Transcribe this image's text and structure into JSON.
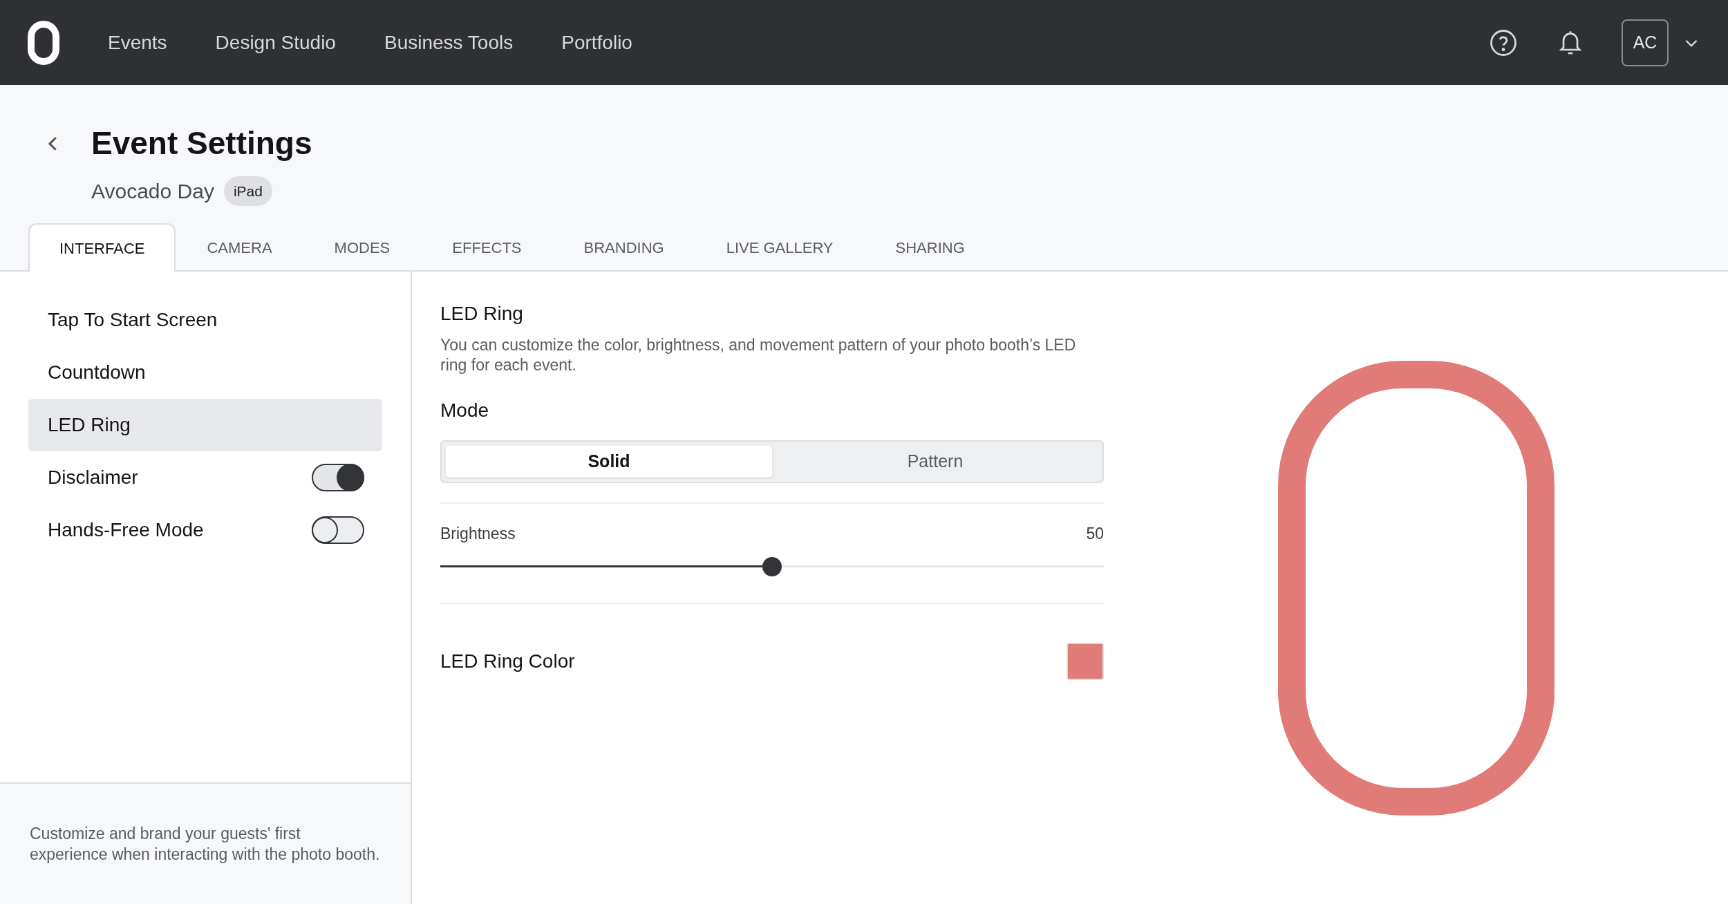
{
  "nav": {
    "links": [
      "Events",
      "Design Studio",
      "Business Tools",
      "Portfolio"
    ],
    "avatar": "AC"
  },
  "page": {
    "title": "Event Settings",
    "event_name": "Avocado Day",
    "device_badge": "iPad"
  },
  "tabs": [
    {
      "label": "INTERFACE",
      "selected": true
    },
    {
      "label": "CAMERA",
      "selected": false
    },
    {
      "label": "MODES",
      "selected": false
    },
    {
      "label": "EFFECTS",
      "selected": false
    },
    {
      "label": "BRANDING",
      "selected": false
    },
    {
      "label": "LIVE GALLERY",
      "selected": false
    },
    {
      "label": "SHARING",
      "selected": false
    }
  ],
  "sidebar": {
    "items": [
      {
        "label": "Tap To Start Screen",
        "kind": "link",
        "selected": false
      },
      {
        "label": "Countdown",
        "kind": "link",
        "selected": false
      },
      {
        "label": "LED Ring",
        "kind": "link",
        "selected": true
      },
      {
        "label": "Disclaimer",
        "kind": "toggle",
        "selected": false,
        "on": true
      },
      {
        "label": "Hands-Free Mode",
        "kind": "toggle",
        "selected": false,
        "on": false
      }
    ],
    "footer": "Customize and brand your guests' first experience when interacting with the photo booth."
  },
  "panel": {
    "title": "LED Ring",
    "description": "You can customize the color, brightness, and movement pattern of your photo booth’s LED ring for each event.",
    "mode_label": "Mode",
    "modes": [
      {
        "label": "Solid",
        "selected": true
      },
      {
        "label": "Pattern",
        "selected": false
      }
    ],
    "brightness": {
      "label": "Brightness",
      "reading": "50",
      "level": 0.5
    },
    "color_label": "LED Ring Color",
    "color": "#e07b78"
  }
}
